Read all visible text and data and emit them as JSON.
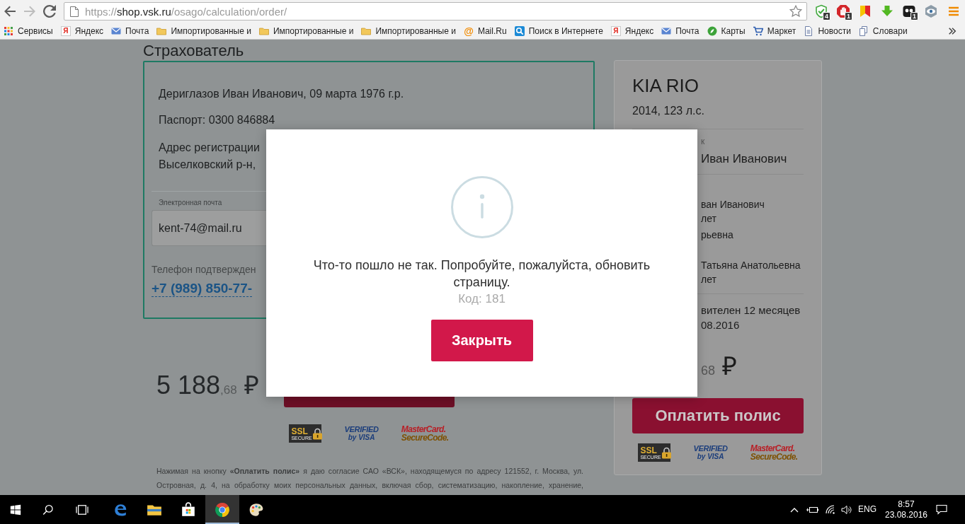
{
  "browser": {
    "nav": [
      {
        "kind": "back",
        "disabled": false
      },
      {
        "kind": "forward",
        "disabled": true
      },
      {
        "kind": "reload",
        "disabled": false
      }
    ],
    "address": {
      "scheme": "https://",
      "host": "shop.vsk.ru",
      "path": "/osago/calculation/order/"
    },
    "extensions": [
      {
        "kind": "shield",
        "badge": "4"
      },
      {
        "kind": "hand",
        "badge": "1"
      },
      {
        "kind": "flag"
      },
      {
        "kind": "download"
      },
      {
        "kind": "mask",
        "badge": "1"
      },
      {
        "kind": "eye"
      }
    ]
  },
  "bookmarks": [
    {
      "kind": "apps",
      "label": "Сервисы"
    },
    {
      "kind": "yandex",
      "glyph": "Я",
      "label": "Яндекс"
    },
    {
      "kind": "mail",
      "label": "Почта"
    },
    {
      "kind": "folder",
      "label": "Импортированные и"
    },
    {
      "kind": "folder",
      "label": "Импортированные и"
    },
    {
      "kind": "folder",
      "label": "Импортированные и"
    },
    {
      "kind": "at",
      "glyph": "@",
      "label": "Mail.Ru"
    },
    {
      "kind": "search",
      "label": "Поиск в Интернете"
    },
    {
      "kind": "yandex",
      "glyph": "Я",
      "label": "Яндекс"
    },
    {
      "kind": "mail",
      "label": "Почта"
    },
    {
      "kind": "maps",
      "label": "Карты"
    },
    {
      "kind": "cart",
      "label": "Маркет"
    },
    {
      "kind": "news",
      "label": "Новости"
    },
    {
      "kind": "dictionary",
      "label": "Словари"
    }
  ],
  "insurant": {
    "heading": "Страхователь",
    "lines": [
      "Дериглазов Иван Иванович, 09 марта 1976 г.р.",
      "Паспорт: 0300 846884"
    ],
    "address_lines": [
      "Адрес регистрации",
      "Выселковский р-н,"
    ],
    "email": {
      "label": "Электронная почта",
      "value": "kent-74@mail.ru"
    },
    "phone": {
      "label": "Телефон подтвержден",
      "value": "+7 (989) 850-77-"
    }
  },
  "checkout": {
    "price": {
      "whole": "5 188",
      "fraction": ",68",
      "currency": "₽"
    },
    "security_logos": [
      {
        "kind": "ssl",
        "lines": [
          "SSL",
          "SECURE"
        ]
      },
      {
        "kind": "visa",
        "lines": [
          "VERIFIED",
          "by VISA"
        ]
      },
      {
        "kind": "mastercard",
        "lines": [
          "MasterCard.",
          "SecureCode."
        ]
      }
    ],
    "consent": "Нажимая на кнопку **«Оплатить полис»** я даю согласие САО «ВСК», находящемуся по адресу 121552, г. Москва, ул. Островная, д. 4, на обработку моих персональных данных, включая сбор, систематизацию, накопление, хранение,"
  },
  "summary": {
    "car": "KIA RIO",
    "car_details": "2014, 123 л.с.",
    "owner": {
      "label": "к",
      "name": "Иван Иванович"
    },
    "drivers": [
      {
        "name": "ван Иванович",
        "age": "лет"
      },
      {
        "name": "рьевна"
      },
      {
        "name": "Татьяна Анатольевна",
        "age": "лет"
      }
    ],
    "term": [
      "вителен 12 месяцев",
      "08.2016"
    ],
    "price": {
      "fraction": "68",
      "currency": "₽"
    },
    "pay_button": "Оплатить полис",
    "security_logos": [
      {
        "kind": "ssl",
        "lines": [
          "SSL",
          "SECURE"
        ]
      },
      {
        "kind": "visa",
        "lines": [
          "VERIFIED",
          "by VISA"
        ]
      },
      {
        "kind": "mastercard",
        "lines": [
          "MasterCard.",
          "SecureCode."
        ]
      }
    ]
  },
  "dialog": {
    "message": "Что-то пошло не так. Попробуйте, пожалуйста, обновить страницу.",
    "code": "Код: 181",
    "close_button": "Закрыть"
  },
  "taskbar": {
    "apps": [
      {
        "kind": "edge",
        "active": false
      },
      {
        "kind": "explorer",
        "active": false
      },
      {
        "kind": "store",
        "active": false
      },
      {
        "kind": "chrome",
        "active": true
      },
      {
        "kind": "paint",
        "active": false
      }
    ],
    "language": "ENG",
    "time": "8:57",
    "date": "23.08.2016"
  }
}
